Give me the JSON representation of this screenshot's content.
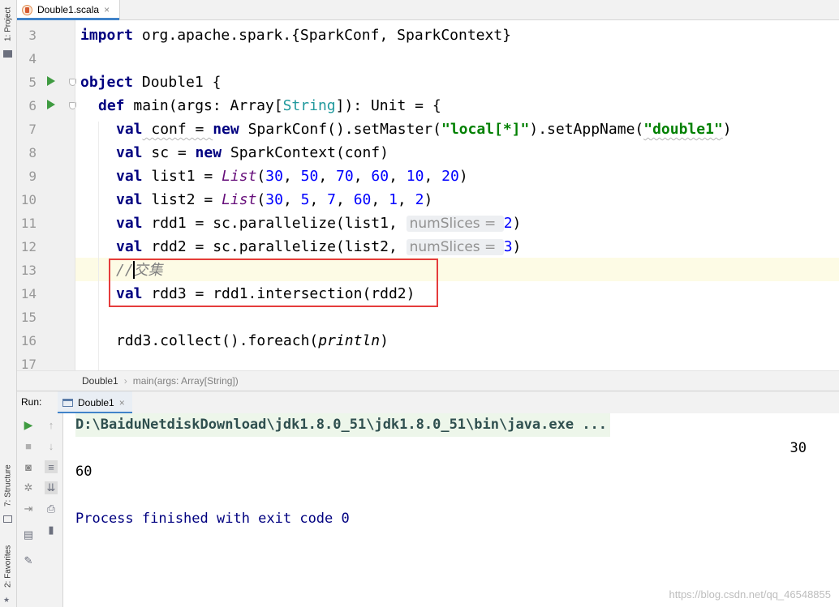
{
  "left_strip": {
    "project_tab": "1: Project",
    "structure_tab": "7: Structure",
    "favorites_tab": "2: Favorites"
  },
  "editor_tab": {
    "file_name": "Double1.scala",
    "close_glyph": "×"
  },
  "editor": {
    "line_numbers": [
      "3",
      "4",
      "5",
      "6",
      "7",
      "8",
      "9",
      "10",
      "11",
      "12",
      "13",
      "14",
      "15",
      "16",
      "17"
    ],
    "line3": {
      "kw": "import",
      "rest": " org.apache.spark.{SparkConf, SparkContext}"
    },
    "line5": {
      "kw": "object",
      "rest": " Double1 {"
    },
    "line6": {
      "kw": "def",
      "a": " main(args: Array[",
      "type": "String",
      "b": "]): Unit = {"
    },
    "line7": {
      "kw1": "val",
      "a": " conf = ",
      "kw2": "new",
      "b": " SparkConf().setMaster(",
      "s1": "\"local[*]\"",
      "c": ").setAppName(",
      "s2": "\"double1\"",
      "d": ")"
    },
    "line8": {
      "kw1": "val",
      "a": " sc = ",
      "kw2": "new",
      "b": " SparkContext(conf)"
    },
    "line9": {
      "kw": "val",
      "a": " list1 = ",
      "fn": "List",
      "b": "(",
      "n1": "30",
      "n2": "50",
      "n3": "70",
      "n4": "60",
      "n5": "10",
      "n6": "20",
      "sep": ", ",
      "c": ")"
    },
    "line10": {
      "kw": "val",
      "a": " list2 = ",
      "fn": "List",
      "b": "(",
      "n1": "30",
      "n2": "5",
      "n3": "7",
      "n4": "60",
      "n5": "1",
      "n6": "2",
      "sep": ", ",
      "c": ")"
    },
    "line11": {
      "kw": "val",
      "a": " rdd1 = sc.parallelize(list1, ",
      "hint": "numSlices = ",
      "num": "2",
      "c": ")"
    },
    "line12": {
      "kw": "val",
      "a": " rdd2 = sc.parallelize(list2, ",
      "hint": "numSlices = ",
      "num": "3",
      "c": ")"
    },
    "line13": {
      "comment": "//交集"
    },
    "line14": {
      "kw": "val",
      "a": " rdd3 = rdd1.intersection(rdd2)"
    },
    "line16": {
      "a": "rdd3.collect().foreach(",
      "fn": "println",
      "b": ")"
    }
  },
  "breadcrumb": {
    "item1": "Double1",
    "sep": "›",
    "item2": "main(args: Array[String])"
  },
  "run_panel": {
    "label": "Run:",
    "tab": "Double1",
    "close_glyph": "×",
    "output": {
      "path": "D:\\BaiduNetdiskDownload\\jdk1.8.0_51\\jdk1.8.0_51\\bin\\java.exe ...",
      "line1": "30",
      "line2": "60",
      "finish": "Process finished with exit code 0"
    }
  },
  "watermark": "https://blog.csdn.net/qq_46548855",
  "colors": {
    "keyword": "#000080",
    "string": "#008000",
    "number": "#0000ff",
    "run_arrow": "#3f9b41",
    "highlight_box": "#e53c3c"
  }
}
